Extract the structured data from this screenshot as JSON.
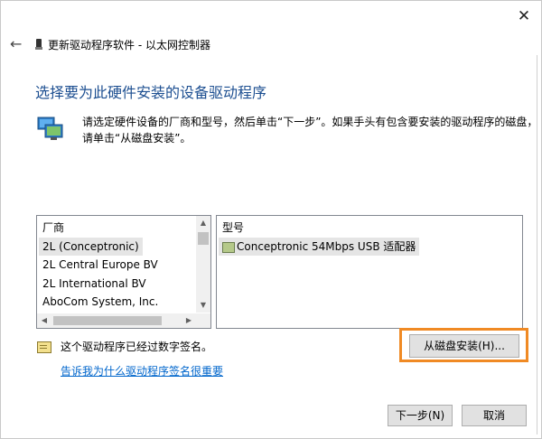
{
  "window": {
    "breadcrumb": "更新驱动程序软件 - 以太网控制器",
    "close_glyph": "✕",
    "back_glyph": "←"
  },
  "heading": "选择要为此硬件安装的设备驱动程序",
  "instructions": {
    "line1": "请选定硬件设备的厂商和型号，然后单击“下一步”。如果手头有包含要安装的驱动程序的磁盘，",
    "line2": "请单击“从磁盘安装”。"
  },
  "manufacturer_list": {
    "header": "厂商",
    "items": [
      "2L (Conceptronic)",
      "2L Central Europe BV",
      "2L International BV",
      "AboCom System, Inc."
    ],
    "selected_index": 0
  },
  "model_list": {
    "header": "型号",
    "items": [
      "Conceptronic 54Mbps USB 适配器"
    ]
  },
  "signature": {
    "text": "这个驱动程序已经过数字签名。",
    "link": "告诉我为什么驱动程序签名很重要"
  },
  "buttons": {
    "have_disk": "从磁盘安装(H)...",
    "next": "下一步(N)",
    "cancel": "取消"
  },
  "colors": {
    "heading": "#1d4f91",
    "link": "#0066cc",
    "highlight": "#f08a24"
  }
}
